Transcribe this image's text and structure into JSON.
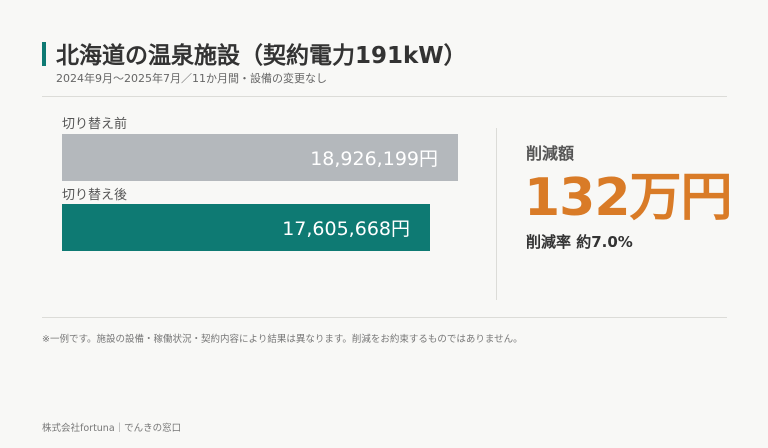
{
  "header": {
    "title": "北海道の温泉施設（契約電力191kW）",
    "subtitle": "2024年9月～2025年7月／11か月間・設備の変更なし"
  },
  "chart_data": {
    "type": "bar",
    "orientation": "horizontal",
    "categories": [
      "切り替え前",
      "切り替え後"
    ],
    "values": [
      18926199,
      17605668
    ],
    "value_labels": [
      "18,926,199円",
      "17,605,668円"
    ],
    "colors": [
      "#b4b8bc",
      "#0e7a73"
    ]
  },
  "summary": {
    "label": "削減額",
    "value": "132万円",
    "rate": "削減率 約7.0%",
    "accent_color": "#d97b27"
  },
  "note": "※一例です。施設の設備・稼働状況・契約内容により結果は異なります。削減をお約束するものではありません。",
  "footer": "株式会社fortuna｜でんきの窓口"
}
